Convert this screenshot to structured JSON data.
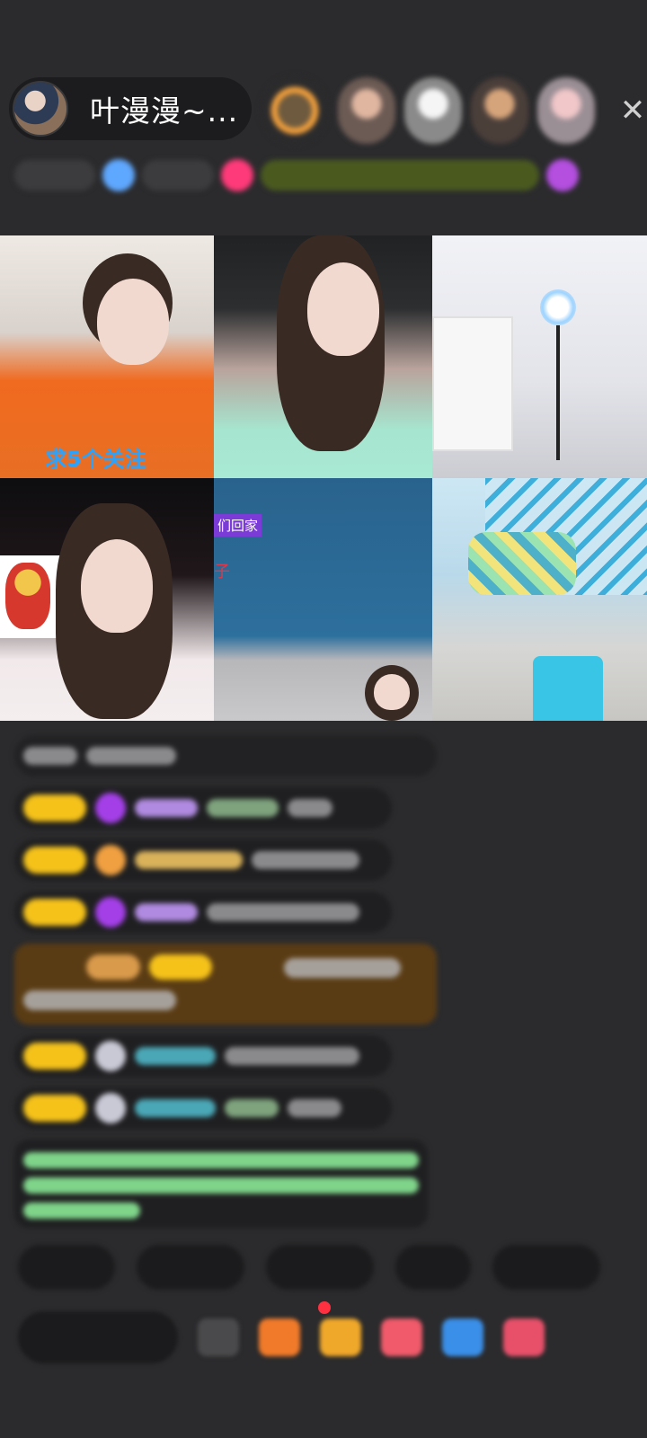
{
  "host": {
    "name": "叶漫漫~...",
    "avatar_icon": "host-avatar-icon"
  },
  "header": {
    "close_icon": "✕"
  },
  "grid": {
    "cells": [
      {
        "overlay_text": "求5个关注"
      },
      {
        "overlay_text": ""
      },
      {
        "overlay_text": ""
      },
      {
        "overlay_text": ""
      },
      {
        "tag_text": "们回家",
        "red_text": "子"
      },
      {
        "overlay_text": ""
      }
    ]
  },
  "colors": {
    "background": "#2b2b2d",
    "badge_gold": "#f5c21a",
    "accent_purple": "#a43fe8",
    "overlay_blue": "#2aa3ff"
  }
}
